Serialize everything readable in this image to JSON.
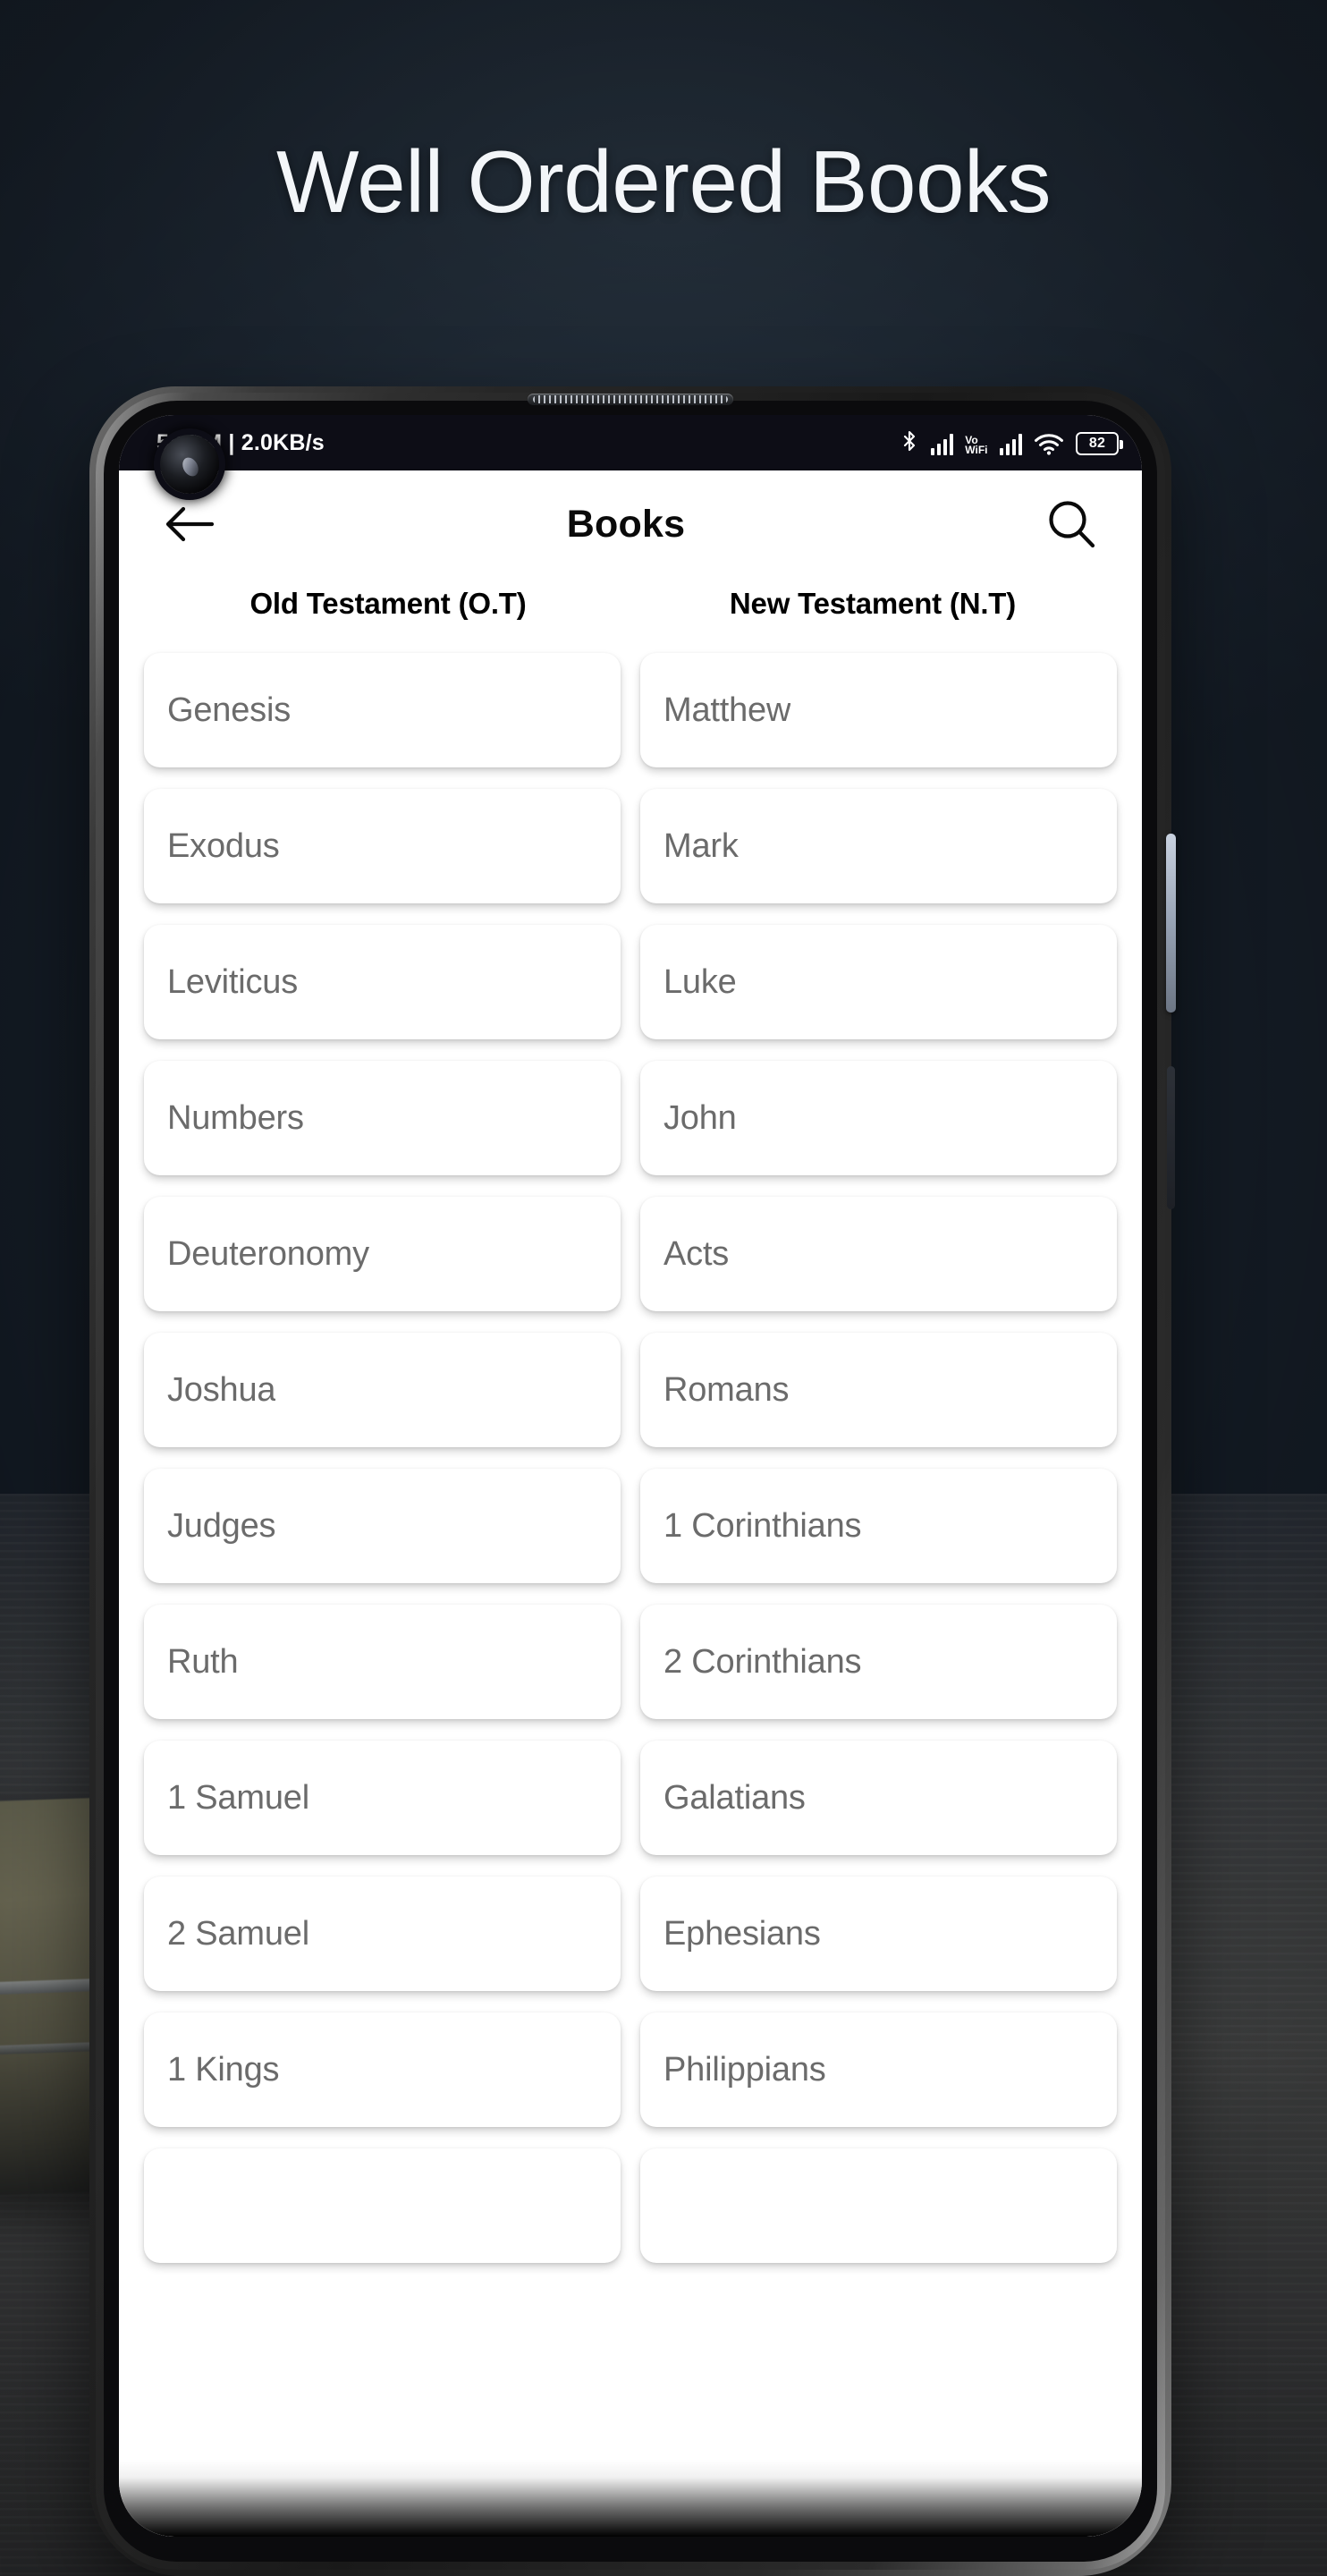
{
  "hero": {
    "title": "Well Ordered Books"
  },
  "status_bar": {
    "left_text": "58 PM | 2.0KB/s",
    "bluetooth_icon": "bluetooth-icon",
    "signal_icon": "signal-bars-icon",
    "vowifi_label_top": "Vo",
    "vowifi_label_bottom": "WiFi",
    "signal2_icon": "signal-bars-icon",
    "wifi_icon": "wifi-icon",
    "battery_level": "82"
  },
  "app_bar": {
    "back_icon": "arrow-left-icon",
    "title": "Books",
    "search_icon": "search-icon"
  },
  "columns": {
    "old_testament_header": "Old Testament (O.T)",
    "new_testament_header": "New Testament (N.T)"
  },
  "old_testament_books": [
    "Genesis",
    "Exodus",
    "Leviticus",
    "Numbers",
    "Deuteronomy",
    "Joshua",
    "Judges",
    "Ruth",
    "1 Samuel",
    "2 Samuel",
    "1 Kings",
    ""
  ],
  "new_testament_books": [
    "Matthew",
    "Mark",
    "Luke",
    "John",
    "Acts",
    "Romans",
    "1 Corinthians",
    "2 Corinthians",
    "Galatians",
    "Ephesians",
    "Philippians",
    ""
  ],
  "colors": {
    "background_dark": "#1c2632",
    "card_text": "#6b6b6b",
    "app_bar_text": "#0a0a0a",
    "status_bar_bg": "#0d0d16",
    "screen_bg": "#ffffff"
  }
}
